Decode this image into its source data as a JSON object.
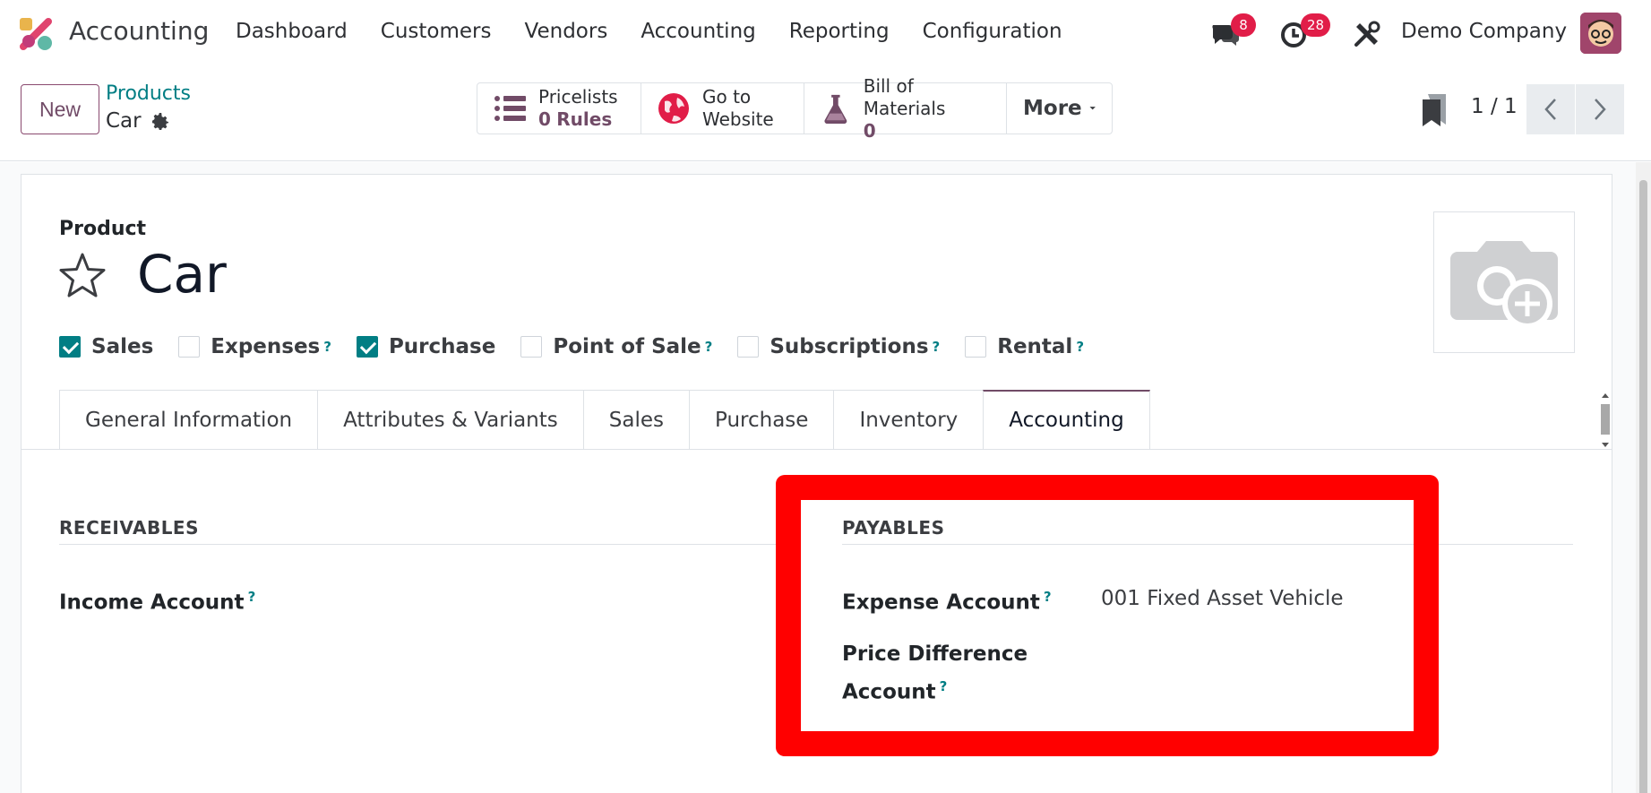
{
  "app": {
    "name": "Accounting",
    "logo": "odoo-app-logo"
  },
  "nav": {
    "items": [
      {
        "id": "dashboard",
        "label": "Dashboard"
      },
      {
        "id": "customers",
        "label": "Customers"
      },
      {
        "id": "vendors",
        "label": "Vendors"
      },
      {
        "id": "accounting",
        "label": "Accounting"
      },
      {
        "id": "reporting",
        "label": "Reporting"
      },
      {
        "id": "configuration",
        "label": "Configuration"
      }
    ],
    "messages_count": "8",
    "activities_count": "28",
    "company": "Demo Company"
  },
  "control": {
    "new_label": "New",
    "breadcrumb_parent": "Products",
    "breadcrumb_current": "Car",
    "smart_buttons": [
      {
        "icon": "list-icon",
        "line1": "Pricelists",
        "num": "0",
        "line2": "Rules"
      },
      {
        "icon": "globe-icon",
        "line1": "Go to",
        "num": "",
        "line2": "Website"
      },
      {
        "icon": "flask-icon",
        "line1": "Bill of Materials",
        "num": "0",
        "line2": ""
      }
    ],
    "more_label": "More",
    "pager": "1 / 1"
  },
  "form": {
    "product_label": "Product",
    "title": "Car",
    "checkboxes": [
      {
        "label": "Sales",
        "checked": true,
        "help": false
      },
      {
        "label": "Expenses",
        "checked": false,
        "help": true
      },
      {
        "label": "Purchase",
        "checked": true,
        "help": false
      },
      {
        "label": "Point of Sale",
        "checked": false,
        "help": true
      },
      {
        "label": "Subscriptions",
        "checked": false,
        "help": true
      },
      {
        "label": "Rental",
        "checked": false,
        "help": true
      }
    ],
    "tabs": [
      {
        "label": "General Information",
        "active": false
      },
      {
        "label": "Attributes & Variants",
        "active": false
      },
      {
        "label": "Sales",
        "active": false
      },
      {
        "label": "Purchase",
        "active": false
      },
      {
        "label": "Inventory",
        "active": false
      },
      {
        "label": "Accounting",
        "active": true
      }
    ],
    "receivables": {
      "title": "RECEIVABLES",
      "income_account_label": "Income Account",
      "income_account_value": ""
    },
    "payables": {
      "title": "PAYABLES",
      "expense_account_label": "Expense Account",
      "expense_account_value": "001 Fixed Asset Vehicle",
      "price_diff_label_1": "Price Difference",
      "price_diff_label_2": "Account",
      "price_diff_value": ""
    },
    "help_mark": "?"
  },
  "colors": {
    "brand": "#714b67",
    "teal": "#017e84",
    "badge": "#e11d48",
    "highlight": "#ff0000"
  }
}
